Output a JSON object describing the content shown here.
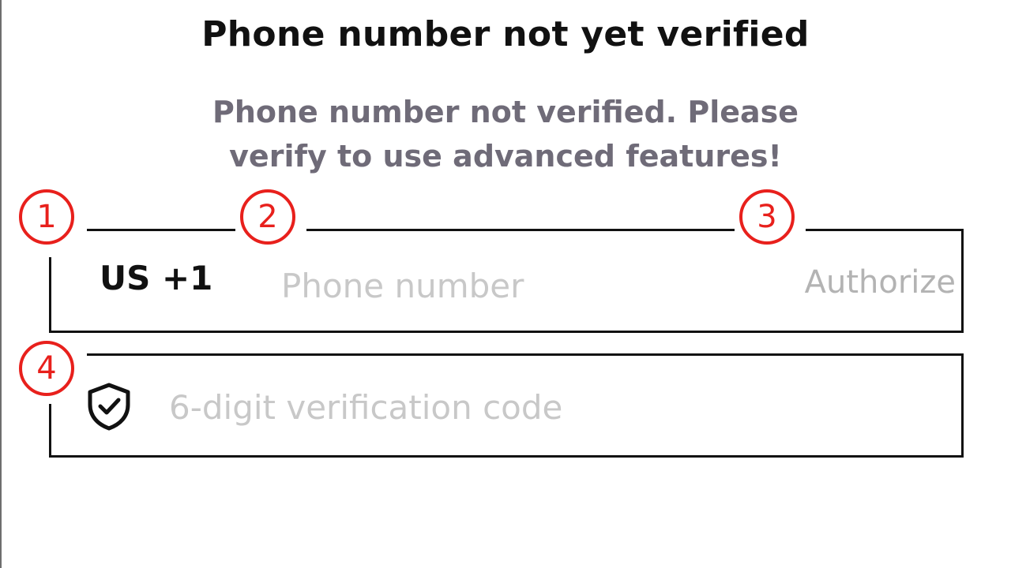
{
  "dialog": {
    "title": "Phone number not yet verified",
    "message": "Phone number not verified. Please verify to use advanced features!"
  },
  "phone_field": {
    "country_code": "US +1",
    "value": "",
    "placeholder": "Phone number",
    "authorize_label": "Authorize"
  },
  "code_field": {
    "value": "",
    "placeholder": "6-digit verification code",
    "icon": "shield-check-icon"
  },
  "annotations": [
    {
      "label": "1"
    },
    {
      "label": "2"
    },
    {
      "label": "3"
    },
    {
      "label": "4"
    }
  ],
  "colors": {
    "annotation": "#e8201c",
    "subtitle": "#6f6b78",
    "placeholder": "#c8c8c8",
    "authorize": "#b3b3b3"
  }
}
